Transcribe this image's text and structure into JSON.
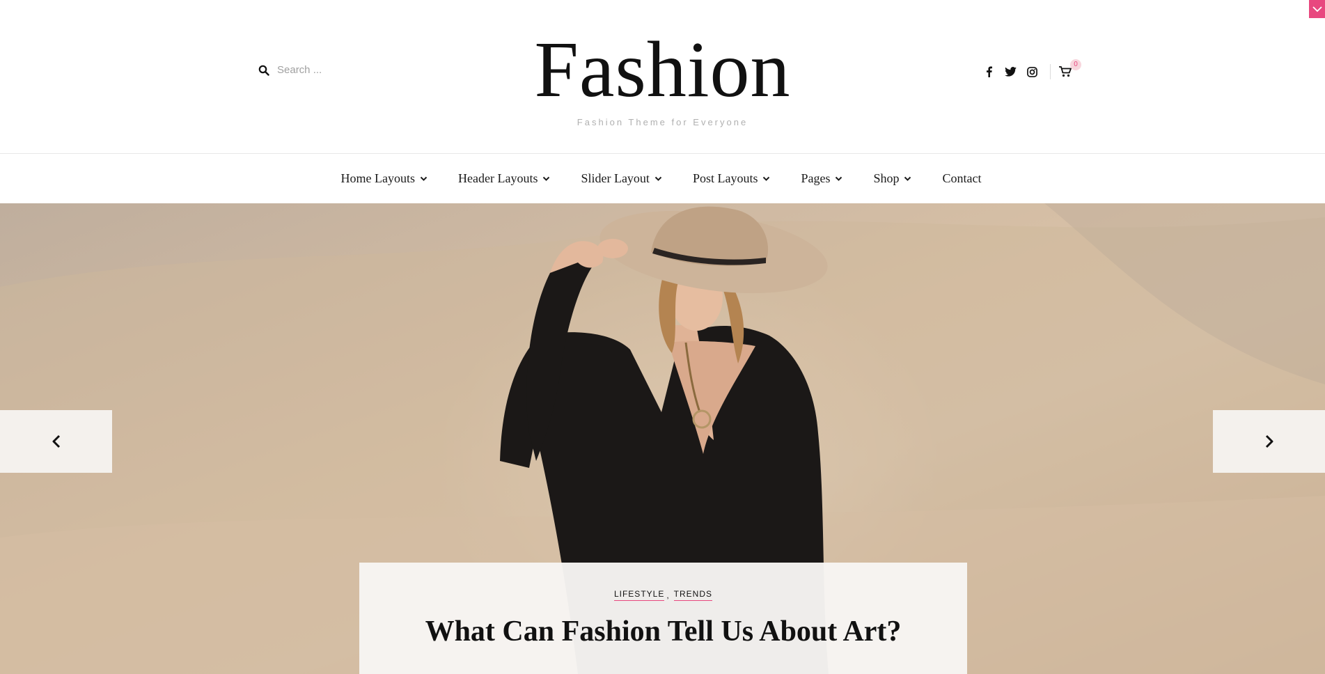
{
  "site": {
    "title": "Fashion",
    "tagline": "Fashion Theme for Everyone"
  },
  "search": {
    "placeholder": "Search ...",
    "value": ""
  },
  "social": {
    "icons": [
      "facebook-icon",
      "twitter-icon",
      "instagram-icon"
    ],
    "cart_count": "0"
  },
  "nav": {
    "items": [
      {
        "label": "Home Layouts",
        "has_dropdown": true
      },
      {
        "label": "Header Layouts",
        "has_dropdown": true
      },
      {
        "label": "Slider Layout",
        "has_dropdown": true
      },
      {
        "label": "Post Layouts",
        "has_dropdown": true
      },
      {
        "label": "Pages",
        "has_dropdown": true
      },
      {
        "label": "Shop",
        "has_dropdown": true
      },
      {
        "label": "Contact",
        "has_dropdown": false
      }
    ]
  },
  "hero": {
    "categories": [
      "LIFESTYLE",
      "TRENDS"
    ],
    "category_separator": ",",
    "post_title": "What Can Fashion Tell Us About Art?"
  },
  "colors": {
    "accent": "#e8487f",
    "text": "#111111",
    "muted": "#b0b0b0"
  }
}
